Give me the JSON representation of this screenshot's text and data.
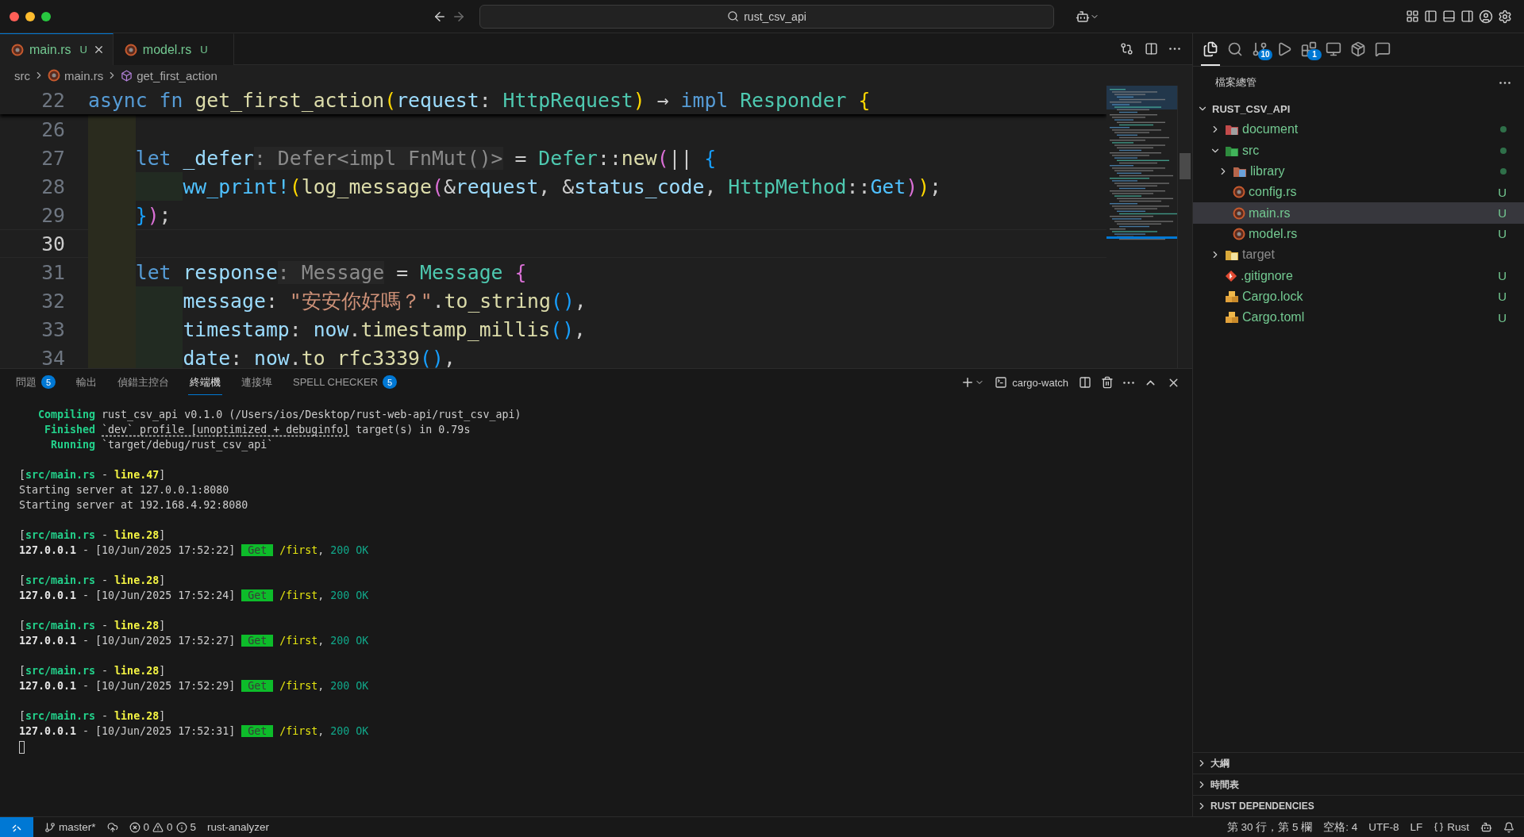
{
  "titlebar": {
    "command_center": "rust_csv_api"
  },
  "editor_tabs": [
    {
      "label": "main.rs",
      "badge": "U",
      "selected": true
    },
    {
      "label": "model.rs",
      "badge": "U",
      "selected": false
    }
  ],
  "breadcrumb": [
    {
      "label": "src",
      "kind": "folder"
    },
    {
      "label": "main.rs",
      "kind": "file"
    },
    {
      "label": "get_first_action",
      "kind": "symbol"
    }
  ],
  "sticky_line": {
    "number": "22",
    "current": false,
    "tokens": [
      {
        "text": "async fn ",
        "kind": "kw"
      },
      {
        "text": "get_first_action",
        "kind": "fn"
      },
      {
        "text": "(",
        "kind": "b1"
      },
      {
        "text": "request",
        "kind": "var"
      },
      {
        "text": ": ",
        "kind": "op"
      },
      {
        "text": "HttpRequest",
        "kind": "type"
      },
      {
        "text": ")",
        "kind": "b1"
      },
      {
        "text": " → ",
        "kind": "op"
      },
      {
        "text": "impl ",
        "kind": "kw"
      },
      {
        "text": "Responder ",
        "kind": "type"
      },
      {
        "text": "{",
        "kind": "b1"
      }
    ]
  },
  "code_lines": [
    {
      "number": "26",
      "current": false
    },
    {
      "number": "27",
      "current": false,
      "tokens": [
        {
          "text": "    let ",
          "kind": "kw"
        },
        {
          "text": "_defer",
          "kind": "var"
        },
        {
          "text": ": Defer<impl FnMut()>",
          "kind": "hint"
        },
        {
          "text": " = ",
          "kind": "op"
        },
        {
          "text": "Defer",
          "kind": "type"
        },
        {
          "text": "::",
          "kind": "op"
        },
        {
          "text": "new",
          "kind": "fn"
        },
        {
          "text": "(",
          "kind": "b2"
        },
        {
          "text": "|| ",
          "kind": "op"
        },
        {
          "text": "{",
          "kind": "b3"
        }
      ]
    },
    {
      "number": "28",
      "current": false,
      "tokens": [
        {
          "text": "        ww_print!",
          "kind": "macro"
        },
        {
          "text": "(",
          "kind": "b1"
        },
        {
          "text": "log_message",
          "kind": "fn"
        },
        {
          "text": "(",
          "kind": "b2"
        },
        {
          "text": "&",
          "kind": "op"
        },
        {
          "text": "request",
          "kind": "var"
        },
        {
          "text": ", &",
          "kind": "op"
        },
        {
          "text": "status_code",
          "kind": "var"
        },
        {
          "text": ", ",
          "kind": "op"
        },
        {
          "text": "HttpMethod",
          "kind": "type"
        },
        {
          "text": "::",
          "kind": "op"
        },
        {
          "text": "Get",
          "kind": "variant"
        },
        {
          "text": ")",
          "kind": "b2"
        },
        {
          "text": ")",
          "kind": "b1"
        },
        {
          "text": ";",
          "kind": "op"
        }
      ]
    },
    {
      "number": "29",
      "current": false,
      "tokens": [
        {
          "text": "    }",
          "kind": "b3"
        },
        {
          "text": ")",
          "kind": "b2"
        },
        {
          "text": ";",
          "kind": "op"
        }
      ]
    },
    {
      "number": "30",
      "current": true
    },
    {
      "number": "31",
      "current": false,
      "tokens": [
        {
          "text": "    let ",
          "kind": "kw"
        },
        {
          "text": "response",
          "kind": "var"
        },
        {
          "text": ": Message",
          "kind": "hint"
        },
        {
          "text": " = ",
          "kind": "op"
        },
        {
          "text": "Message ",
          "kind": "type"
        },
        {
          "text": "{",
          "kind": "b2"
        }
      ]
    },
    {
      "number": "32",
      "current": false,
      "tokens": [
        {
          "text": "        message",
          "kind": "var"
        },
        {
          "text": ": ",
          "kind": "op"
        },
        {
          "text": "\"安安你好嗎？\"",
          "kind": "str"
        },
        {
          "text": ".",
          "kind": "op"
        },
        {
          "text": "to_string",
          "kind": "fn"
        },
        {
          "text": "()",
          "kind": "b3"
        },
        {
          "text": ",",
          "kind": "op"
        }
      ]
    },
    {
      "number": "33",
      "current": false,
      "tokens": [
        {
          "text": "        timestamp",
          "kind": "var"
        },
        {
          "text": ": ",
          "kind": "op"
        },
        {
          "text": "now",
          "kind": "var"
        },
        {
          "text": ".",
          "kind": "op"
        },
        {
          "text": "timestamp_millis",
          "kind": "fn"
        },
        {
          "text": "()",
          "kind": "b3"
        },
        {
          "text": ",",
          "kind": "op"
        }
      ]
    },
    {
      "number": "34",
      "current": false,
      "tokens": [
        {
          "text": "        date",
          "kind": "var"
        },
        {
          "text": ": ",
          "kind": "op"
        },
        {
          "text": "now",
          "kind": "var"
        },
        {
          "text": ".",
          "kind": "op"
        },
        {
          "text": "to_rfc3339",
          "kind": "fn"
        },
        {
          "text": "()",
          "kind": "b3"
        },
        {
          "text": ",",
          "kind": "op"
        }
      ]
    }
  ],
  "panel": {
    "tabs": [
      {
        "label": "問題",
        "badge": "5",
        "selected": false
      },
      {
        "label": "輸出",
        "selected": false
      },
      {
        "label": "偵錯主控台",
        "selected": false
      },
      {
        "label": "終端機",
        "selected": true
      },
      {
        "label": "連接埠",
        "selected": false
      },
      {
        "label": "SPELL CHECKER",
        "badge": "5",
        "selected": false
      }
    ],
    "terminal_name": "cargo-watch",
    "terminal_blocks": [
      {
        "lines": [
          {
            "segments": [
              {
                "text": "Compiling",
                "kind": "label"
              },
              {
                "text": "rust_csv_api v0.1.0 (/Users/ios/Desktop/rust-web-api/rust_csv_api)",
                "kind": "plain"
              }
            ]
          },
          {
            "segments": [
              {
                "text": "Finished",
                "kind": "label"
              },
              {
                "text": "`dev` profile [unoptimized + debuginfo]",
                "kind": "link"
              },
              {
                "text": " target(s) in 0.79s",
                "kind": "plain"
              }
            ]
          },
          {
            "segments": [
              {
                "text": "Running",
                "kind": "label"
              },
              {
                "text": "`target/debug/rust_csv_api`",
                "kind": "plain"
              }
            ]
          }
        ]
      },
      {
        "lines": [
          {
            "segments": [
              {
                "text": "[",
                "kind": "plain"
              },
              {
                "text": "src/main.rs",
                "kind": "path"
              },
              {
                "text": " - ",
                "kind": "plain"
              },
              {
                "text": "line.47",
                "kind": "lineref"
              },
              {
                "text": "]",
                "kind": "plain"
              }
            ]
          },
          {
            "segments": [
              {
                "text": "Starting server at 127.0.0.1:8080",
                "kind": "plain"
              }
            ]
          },
          {
            "segments": [
              {
                "text": "Starting server at 192.168.4.92:8080",
                "kind": "plain"
              }
            ]
          }
        ]
      },
      {
        "lines": [
          {
            "segments": [
              {
                "text": "[",
                "kind": "plain"
              },
              {
                "text": "src/main.rs",
                "kind": "path"
              },
              {
                "text": " - ",
                "kind": "plain"
              },
              {
                "text": "line.28",
                "kind": "lineref"
              },
              {
                "text": "]",
                "kind": "plain"
              }
            ]
          },
          {
            "segments": [
              {
                "text": "127.0.0.1",
                "kind": "ip"
              },
              {
                "text": " - [10/Jun/2025 17:52:22]",
                "kind": "plain"
              },
              {
                "text": "Get",
                "kind": "method"
              },
              {
                "text": "/first",
                "kind": "route"
              },
              {
                "text": ", ",
                "kind": "plain"
              },
              {
                "text": "200 OK",
                "kind": "status"
              }
            ]
          }
        ]
      },
      {
        "lines": [
          {
            "segments": [
              {
                "text": "[",
                "kind": "plain"
              },
              {
                "text": "src/main.rs",
                "kind": "path"
              },
              {
                "text": " - ",
                "kind": "plain"
              },
              {
                "text": "line.28",
                "kind": "lineref"
              },
              {
                "text": "]",
                "kind": "plain"
              }
            ]
          },
          {
            "segments": [
              {
                "text": "127.0.0.1",
                "kind": "ip"
              },
              {
                "text": " - [10/Jun/2025 17:52:24]",
                "kind": "plain"
              },
              {
                "text": "Get",
                "kind": "method"
              },
              {
                "text": "/first",
                "kind": "route"
              },
              {
                "text": ", ",
                "kind": "plain"
              },
              {
                "text": "200 OK",
                "kind": "status"
              }
            ]
          }
        ]
      },
      {
        "lines": [
          {
            "segments": [
              {
                "text": "[",
                "kind": "plain"
              },
              {
                "text": "src/main.rs",
                "kind": "path"
              },
              {
                "text": " - ",
                "kind": "plain"
              },
              {
                "text": "line.28",
                "kind": "lineref"
              },
              {
                "text": "]",
                "kind": "plain"
              }
            ]
          },
          {
            "segments": [
              {
                "text": "127.0.0.1",
                "kind": "ip"
              },
              {
                "text": " - [10/Jun/2025 17:52:27]",
                "kind": "plain"
              },
              {
                "text": "Get",
                "kind": "method"
              },
              {
                "text": "/first",
                "kind": "route"
              },
              {
                "text": ", ",
                "kind": "plain"
              },
              {
                "text": "200 OK",
                "kind": "status"
              }
            ]
          }
        ]
      },
      {
        "lines": [
          {
            "segments": [
              {
                "text": "[",
                "kind": "plain"
              },
              {
                "text": "src/main.rs",
                "kind": "path"
              },
              {
                "text": " - ",
                "kind": "plain"
              },
              {
                "text": "line.28",
                "kind": "lineref"
              },
              {
                "text": "]",
                "kind": "plain"
              }
            ]
          },
          {
            "segments": [
              {
                "text": "127.0.0.1",
                "kind": "ip"
              },
              {
                "text": " - [10/Jun/2025 17:52:29]",
                "kind": "plain"
              },
              {
                "text": "Get",
                "kind": "method"
              },
              {
                "text": "/first",
                "kind": "route"
              },
              {
                "text": ", ",
                "kind": "plain"
              },
              {
                "text": "200 OK",
                "kind": "status"
              }
            ]
          }
        ]
      },
      {
        "lines": [
          {
            "segments": [
              {
                "text": "[",
                "kind": "plain"
              },
              {
                "text": "src/main.rs",
                "kind": "path"
              },
              {
                "text": " - ",
                "kind": "plain"
              },
              {
                "text": "line.28",
                "kind": "lineref"
              },
              {
                "text": "]",
                "kind": "plain"
              }
            ]
          },
          {
            "segments": [
              {
                "text": "127.0.0.1",
                "kind": "ip"
              },
              {
                "text": " - [10/Jun/2025 17:52:31]",
                "kind": "plain"
              },
              {
                "text": "Get",
                "kind": "method"
              },
              {
                "text": "/first",
                "kind": "route"
              },
              {
                "text": ", ",
                "kind": "plain"
              },
              {
                "text": "200 OK",
                "kind": "status"
              }
            ]
          }
        ]
      }
    ]
  },
  "sidebar": {
    "activity": [
      {
        "kind": "files",
        "selected": true
      },
      {
        "kind": "search",
        "selected": false
      },
      {
        "kind": "scm",
        "selected": false,
        "badge": "10"
      },
      {
        "kind": "debug",
        "selected": false
      },
      {
        "kind": "extensions",
        "selected": false,
        "badge": "1"
      },
      {
        "kind": "remote",
        "selected": false
      },
      {
        "kind": "packages",
        "selected": false
      },
      {
        "kind": "chat",
        "selected": false
      }
    ],
    "title": "檔案總管",
    "root": {
      "label": "RUST_CSV_API",
      "expanded": true
    },
    "tree": [
      {
        "label": "document",
        "kind": "folder-doc",
        "ignored": false,
        "dot": true,
        "expanded": false,
        "selected": false
      },
      {
        "label": "src",
        "kind": "folder-src",
        "ignored": false,
        "dot": true,
        "expanded": true,
        "selected": false,
        "children": [
          {
            "label": "library",
            "kind": "folder-lib",
            "ignored": false,
            "dot": true,
            "expanded": false,
            "selected": false
          },
          {
            "label": "config.rs",
            "kind": "rust",
            "ignored": false,
            "dot": false,
            "badge": "U",
            "selected": false
          },
          {
            "label": "main.rs",
            "kind": "rust",
            "ignored": false,
            "dot": false,
            "badge": "U",
            "selected": true
          },
          {
            "label": "model.rs",
            "kind": "rust",
            "ignored": false,
            "dot": false,
            "badge": "U",
            "selected": false
          }
        ]
      },
      {
        "label": "target",
        "kind": "folder-target",
        "ignored": true,
        "dot": false,
        "expanded": false,
        "selected": false
      },
      {
        "label": ".gitignore",
        "kind": "git",
        "ignored": false,
        "dot": false,
        "badge": "U",
        "selected": false
      },
      {
        "label": "Cargo.lock",
        "kind": "cargo",
        "ignored": false,
        "dot": false,
        "badge": "U",
        "selected": false
      },
      {
        "label": "Cargo.toml",
        "kind": "cargo",
        "ignored": false,
        "dot": false,
        "badge": "U",
        "selected": false
      }
    ],
    "sections": [
      {
        "label": "大綱",
        "expanded": false
      },
      {
        "label": "時間表",
        "expanded": false
      },
      {
        "label": "RUST DEPENDENCIES",
        "expanded": false
      }
    ]
  },
  "status_bar": {
    "branch": "master*",
    "errors": "0",
    "warnings": "0",
    "infos": "5",
    "server": "rust-analyzer",
    "position": "第 30 行，第 5 欄",
    "indent": "空格: 4",
    "encoding": "UTF-8",
    "eol": "LF",
    "language": "Rust"
  }
}
